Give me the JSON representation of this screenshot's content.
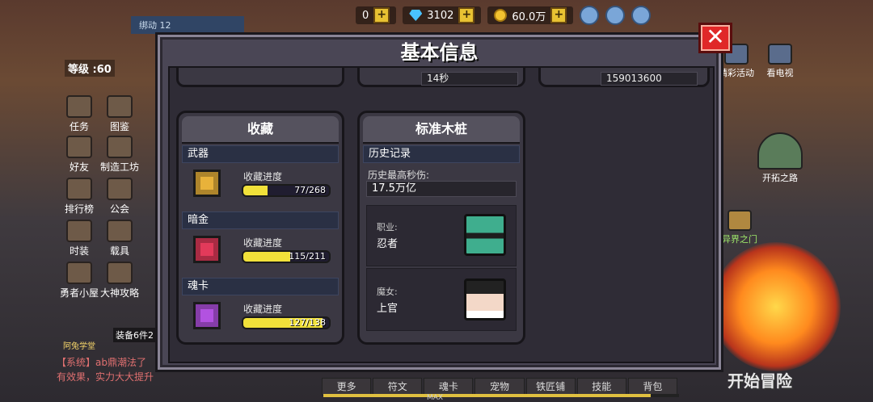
{
  "topbar": {
    "res1": "0",
    "gems": "3102",
    "gold": "60.0万"
  },
  "left_hud": {
    "header": "绑动 12",
    "level": "等级 :60",
    "buttons": [
      {
        "label": "任务"
      },
      {
        "label": "图鉴"
      },
      {
        "label": "好友"
      },
      {
        "label": "制造工坊"
      },
      {
        "label": "排行榜"
      },
      {
        "label": "公会"
      },
      {
        "label": "时装"
      },
      {
        "label": "载具"
      },
      {
        "label": "勇者小屋"
      },
      {
        "label": "大神攻略"
      }
    ],
    "equip": "装备6件2",
    "student": "阿兔学堂",
    "chat": "【系统】ab鼎潮法了",
    "chat2": "有效果，实力大大提升"
  },
  "right_hud": {
    "buttons": [
      {
        "label": "精彩活动"
      },
      {
        "label": "看电视"
      },
      {
        "label": "开拓之路"
      },
      {
        "label": "异界之门"
      }
    ],
    "start": "开始冒险"
  },
  "bottom_tabs": [
    "更多",
    "符文",
    "魂卡",
    "宠物",
    "铁匠铺",
    "技能",
    "背包"
  ],
  "bottom_max": "MAX",
  "dialog": {
    "title": "基本信息",
    "stub_mid": "14秒",
    "stub_right": "159013600",
    "collection": {
      "title": "收藏",
      "progress_label": "收藏进度",
      "sections": [
        {
          "name": "武器",
          "text": "77/268",
          "progress": 0.287,
          "color": "#e8b23a"
        },
        {
          "name": "暗金",
          "text": "115/211",
          "progress": 0.545,
          "color": "#e23a5a"
        },
        {
          "name": "魂卡",
          "text": "127/138",
          "progress": 0.92,
          "color": "#b252e0"
        }
      ]
    },
    "dummy": {
      "title": "标准木桩",
      "history_header": "历史记录",
      "best_label": "历史最高秒伤:",
      "best_value": "17.5万亿",
      "job_label": "职业:",
      "job_value": "忍者",
      "witch_label": "魔女:",
      "witch_value": "上官"
    }
  }
}
